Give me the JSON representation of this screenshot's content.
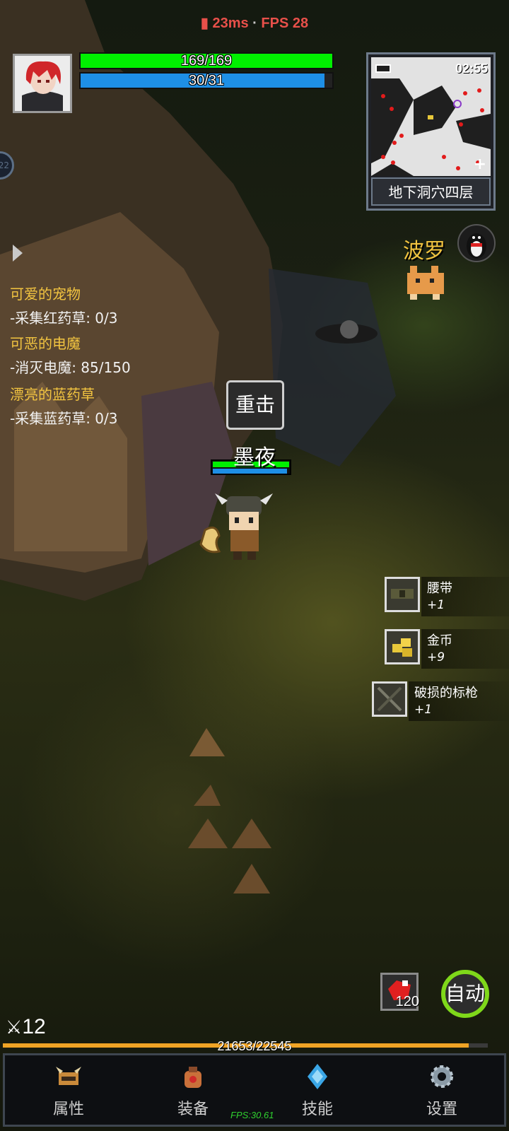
{
  "status": {
    "ping": "23ms",
    "separator": "·",
    "fps": "FPS 28"
  },
  "player": {
    "hp_text": "169/169",
    "hp_fraction": 1.0,
    "mp_text": "30/31",
    "mp_fraction": 0.968,
    "name": "墨夜",
    "skill_bubble": "重击",
    "level": "12",
    "xp_text": "21653/22545",
    "xp_fraction": 0.96
  },
  "minimap": {
    "time": "02:55",
    "location": "地下洞穴四层",
    "battery_icon": "battery-icon",
    "zoom_icon": "plus-icon"
  },
  "side_tab": {
    "text": "22"
  },
  "quests": [
    {
      "title": "可爱的宠物",
      "task": "-采集红药草: 0/3"
    },
    {
      "title": "可恶的电魔",
      "task": "-消灭电魔: 85/150"
    },
    {
      "title": "漂亮的蓝药草",
      "task": "-采集蓝药草: 0/3"
    }
  ],
  "pet": {
    "name": "波罗"
  },
  "loot": [
    {
      "name": "腰带",
      "count": "+1",
      "icon": "belt-icon"
    },
    {
      "name": "金币",
      "count": "+9",
      "icon": "gold-coin-icon"
    },
    {
      "name": "破损的标枪",
      "count": "+1",
      "icon": "javelin-icon"
    }
  ],
  "quick": {
    "potion_count": "120",
    "auto_label": "自动"
  },
  "nav": [
    {
      "label": "属性",
      "icon": "helmet-icon"
    },
    {
      "label": "装备",
      "icon": "bag-icon"
    },
    {
      "label": "技能",
      "icon": "crystal-icon"
    },
    {
      "label": "设置",
      "icon": "gear-icon"
    }
  ],
  "footer_fps": "FPS:30.61",
  "colors": {
    "hp": "#00f000",
    "mp": "#1e8fe6",
    "quest_title": "#f2c440",
    "xp": "#f0a325",
    "ping": "#e8504a"
  }
}
